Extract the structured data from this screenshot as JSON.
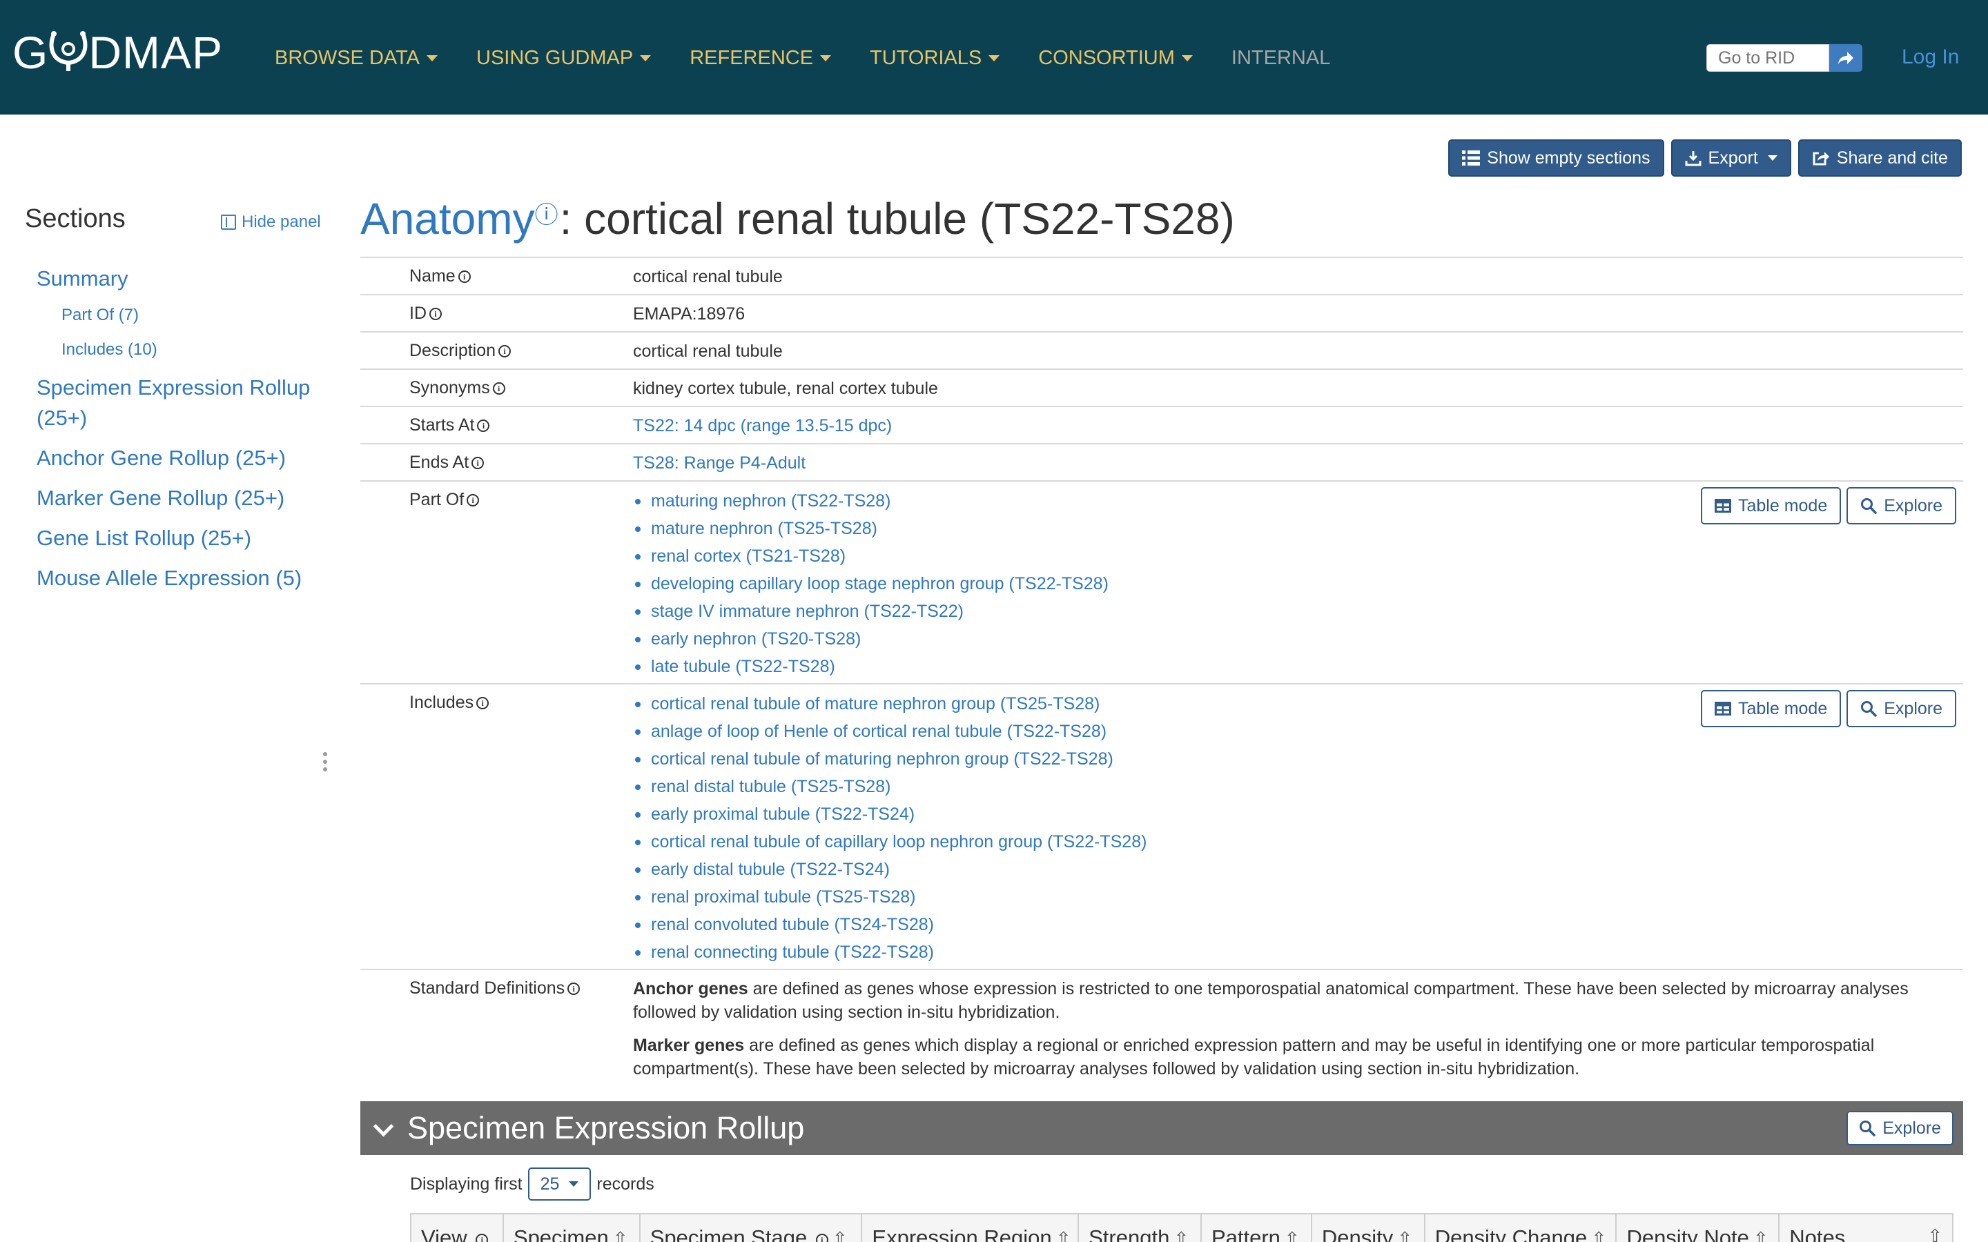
{
  "navbar": {
    "logo_text_left": "G",
    "logo_text_right": "DMAP",
    "menu": [
      {
        "label": "BROWSE DATA",
        "has_caret": true
      },
      {
        "label": "USING GUDMAP",
        "has_caret": true
      },
      {
        "label": "REFERENCE",
        "has_caret": true
      },
      {
        "label": "TUTORIALS",
        "has_caret": true
      },
      {
        "label": "CONSORTIUM",
        "has_caret": true
      },
      {
        "label": "INTERNAL",
        "has_caret": false,
        "disabled": true
      }
    ],
    "rid_placeholder": "Go to RID",
    "login_label": "Log In"
  },
  "actions": {
    "show_empty": "Show empty sections",
    "export": "Export",
    "share": "Share and cite"
  },
  "sidebar": {
    "title": "Sections",
    "hide_panel": "Hide panel",
    "items": [
      {
        "label": "Summary",
        "level": 1
      },
      {
        "label": "Part Of (7)",
        "level": 2
      },
      {
        "label": "Includes (10)",
        "level": 2
      },
      {
        "label": "Specimen Expression Rollup (25+)",
        "level": 1
      },
      {
        "label": "Anchor Gene Rollup (25+)",
        "level": 1
      },
      {
        "label": "Marker Gene Rollup (25+)",
        "level": 1
      },
      {
        "label": "Gene List Rollup (25+)",
        "level": 1
      },
      {
        "label": "Mouse Allele Expression (5)",
        "level": 1
      }
    ]
  },
  "record": {
    "table_name": "Anatomy",
    "title_rest": ": cortical renal tubule (TS22-TS28)",
    "fields": {
      "name": {
        "label": "Name",
        "value": "cortical renal tubule"
      },
      "id": {
        "label": "ID",
        "value": "EMAPA:18976"
      },
      "description": {
        "label": "Description",
        "value": "cortical renal tubule"
      },
      "synonyms": {
        "label": "Synonyms",
        "value": "kidney cortex tubule, renal cortex tubule"
      },
      "starts_at": {
        "label": "Starts At",
        "value": "TS22: 14 dpc (range 13.5-15 dpc)"
      },
      "ends_at": {
        "label": "Ends At",
        "value": "TS28: Range P4-Adult"
      }
    },
    "part_of": {
      "label": "Part Of",
      "items": [
        "maturing nephron (TS22-TS28)",
        "mature nephron (TS25-TS28)",
        "renal cortex (TS21-TS28)",
        "developing capillary loop stage nephron group (TS22-TS28)",
        "stage IV immature nephron (TS22-TS22)",
        "early nephron (TS20-TS28)",
        "late tubule (TS22-TS28)"
      ]
    },
    "includes": {
      "label": "Includes",
      "items": [
        "cortical renal tubule of mature nephron group (TS25-TS28)",
        "anlage of loop of Henle of cortical renal tubule (TS22-TS28)",
        "cortical renal tubule of maturing nephron group (TS22-TS28)",
        "renal distal tubule (TS25-TS28)",
        "early proximal tubule (TS22-TS24)",
        "cortical renal tubule of capillary loop nephron group (TS22-TS28)",
        "early distal tubule (TS22-TS24)",
        "renal proximal tubule (TS25-TS28)",
        "renal convoluted tubule (TS24-TS28)",
        "renal connecting tubule (TS22-TS28)"
      ]
    },
    "table_mode_label": "Table mode",
    "explore_label": "Explore",
    "standard_definitions": {
      "label": "Standard Definitions",
      "anchor_term": "Anchor genes",
      "anchor_text": " are defined as genes whose expression is restricted to one temporospatial anatomical compartment. These have been selected by microarray analyses followed by validation using section in-situ hybridization.",
      "marker_term": "Marker genes",
      "marker_text": " are defined as genes which display a regional or enriched expression pattern and may be useful in identifying one or more particular temporospatial compartment(s). These have been selected by microarray analyses followed by validation using section in-situ hybridization."
    }
  },
  "specimen_rollup": {
    "title": "Specimen Expression Rollup",
    "explore_label": "Explore",
    "display_prefix": "Displaying first",
    "page_size": "25",
    "display_suffix": "records",
    "columns": [
      "View",
      "Specimen",
      "Specimen Stage",
      "Expression Region",
      "Strength",
      "Pattern",
      "Density",
      "Density Change",
      "Density Note",
      "Notes"
    ]
  },
  "colors": {
    "navbar_bg": "#0c4151",
    "nav_text": "#e9c467",
    "link": "#2f78c2",
    "button_dark": "#315b8a",
    "section_header_bg": "#6b6b6b"
  }
}
